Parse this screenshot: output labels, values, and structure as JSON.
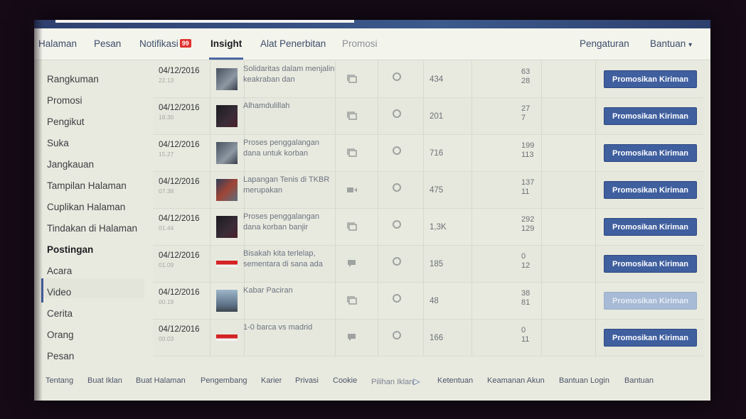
{
  "nav": {
    "items": [
      "Halaman",
      "Pesan",
      "Notifikasi",
      "Insight",
      "Alat Penerbitan",
      "Promosi"
    ],
    "notif_badge": "99",
    "settings": "Pengaturan",
    "help": "Bantuan",
    "help_caret": "▾"
  },
  "sidebar": {
    "items": [
      "Rangkuman",
      "Promosi",
      "Pengikut",
      "Suka",
      "Jangkauan",
      "Tampilan Halaman",
      "Cuplikan Halaman",
      "Tindakan di Halaman",
      "Postingan",
      "Acara",
      "Video",
      "Cerita",
      "Orang",
      "Pesan"
    ],
    "active": "Postingan"
  },
  "posts": [
    {
      "date": "04/12/2016",
      "time": "22.13",
      "title": "Solidaritas dalam menjalin keakraban dan",
      "type": "album-icon",
      "reach": "434",
      "eng1": "63",
      "eng2": "28",
      "button": "Promosikan Kiriman",
      "enabled": true
    },
    {
      "date": "04/12/2016",
      "time": "18.30",
      "title": "Alhamdulillah",
      "type": "album-icon",
      "reach": "201",
      "eng1": "27",
      "eng2": "7",
      "button": "Promosikan Kiriman",
      "enabled": true
    },
    {
      "date": "04/12/2016",
      "time": "15.27",
      "title": "Proses penggalangan dana untuk korban",
      "type": "album-icon",
      "reach": "716",
      "eng1": "199",
      "eng2": "113",
      "button": "Promosikan Kiriman",
      "enabled": true
    },
    {
      "date": "04/12/2016",
      "time": "07.38",
      "title": "Lapangan Tenis di TKBR merupakan",
      "type": "video-icon",
      "reach": "475",
      "eng1": "137",
      "eng2": "11",
      "button": "Promosikan Kiriman",
      "enabled": true
    },
    {
      "date": "04/12/2016",
      "time": "01.44",
      "title": "Proses penggalangan dana korban banjir",
      "type": "album-icon",
      "reach": "1,3K",
      "eng1": "292",
      "eng2": "129",
      "button": "Promosikan Kiriman",
      "enabled": true
    },
    {
      "date": "04/12/2016",
      "time": "01.09",
      "title": "Bisakah kita terlelap, sementara di sana ada",
      "type": "status-icon",
      "reach": "185",
      "eng1": "0",
      "eng2": "12",
      "button": "Promosikan Kiriman",
      "enabled": true
    },
    {
      "date": "04/12/2016",
      "time": "00.19",
      "title": "Kabar Paciran",
      "type": "album-icon",
      "reach": "48",
      "eng1": "38",
      "eng2": "81",
      "button": "Promosikan Kiriman",
      "enabled": false
    },
    {
      "date": "04/12/2016",
      "time": "00.03",
      "title": "1-0 barca vs madrid",
      "type": "status-icon",
      "reach": "166",
      "eng1": "0",
      "eng2": "11",
      "button": "Promosikan Kiriman",
      "enabled": true
    }
  ],
  "footer": {
    "links": [
      "Tentang",
      "Buat Iklan",
      "Buat Halaman",
      "Pengembang",
      "Karier",
      "Privasi",
      "Cookie",
      "Pilihan Iklan",
      "Ketentuan",
      "Keamanan Akun",
      "Bantuan Login",
      "Bantuan"
    ],
    "adchoices_glyph": "▷"
  },
  "colors": {
    "accent": "#3f5f9e",
    "badge": "#e0302e"
  }
}
